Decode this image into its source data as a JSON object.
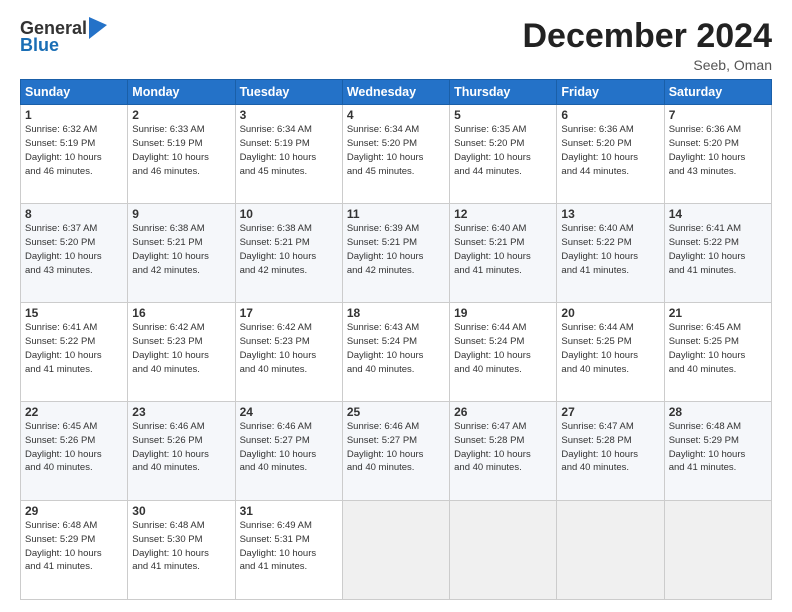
{
  "header": {
    "logo_line1": "General",
    "logo_line2": "Blue",
    "month_title": "December 2024",
    "subtitle": "Seeb, Oman"
  },
  "days_of_week": [
    "Sunday",
    "Monday",
    "Tuesday",
    "Wednesday",
    "Thursday",
    "Friday",
    "Saturday"
  ],
  "weeks": [
    [
      {
        "day": "1",
        "info": "Sunrise: 6:32 AM\nSunset: 5:19 PM\nDaylight: 10 hours\nand 46 minutes."
      },
      {
        "day": "2",
        "info": "Sunrise: 6:33 AM\nSunset: 5:19 PM\nDaylight: 10 hours\nand 46 minutes."
      },
      {
        "day": "3",
        "info": "Sunrise: 6:34 AM\nSunset: 5:19 PM\nDaylight: 10 hours\nand 45 minutes."
      },
      {
        "day": "4",
        "info": "Sunrise: 6:34 AM\nSunset: 5:20 PM\nDaylight: 10 hours\nand 45 minutes."
      },
      {
        "day": "5",
        "info": "Sunrise: 6:35 AM\nSunset: 5:20 PM\nDaylight: 10 hours\nand 44 minutes."
      },
      {
        "day": "6",
        "info": "Sunrise: 6:36 AM\nSunset: 5:20 PM\nDaylight: 10 hours\nand 44 minutes."
      },
      {
        "day": "7",
        "info": "Sunrise: 6:36 AM\nSunset: 5:20 PM\nDaylight: 10 hours\nand 43 minutes."
      }
    ],
    [
      {
        "day": "8",
        "info": "Sunrise: 6:37 AM\nSunset: 5:20 PM\nDaylight: 10 hours\nand 43 minutes."
      },
      {
        "day": "9",
        "info": "Sunrise: 6:38 AM\nSunset: 5:21 PM\nDaylight: 10 hours\nand 42 minutes."
      },
      {
        "day": "10",
        "info": "Sunrise: 6:38 AM\nSunset: 5:21 PM\nDaylight: 10 hours\nand 42 minutes."
      },
      {
        "day": "11",
        "info": "Sunrise: 6:39 AM\nSunset: 5:21 PM\nDaylight: 10 hours\nand 42 minutes."
      },
      {
        "day": "12",
        "info": "Sunrise: 6:40 AM\nSunset: 5:21 PM\nDaylight: 10 hours\nand 41 minutes."
      },
      {
        "day": "13",
        "info": "Sunrise: 6:40 AM\nSunset: 5:22 PM\nDaylight: 10 hours\nand 41 minutes."
      },
      {
        "day": "14",
        "info": "Sunrise: 6:41 AM\nSunset: 5:22 PM\nDaylight: 10 hours\nand 41 minutes."
      }
    ],
    [
      {
        "day": "15",
        "info": "Sunrise: 6:41 AM\nSunset: 5:22 PM\nDaylight: 10 hours\nand 41 minutes."
      },
      {
        "day": "16",
        "info": "Sunrise: 6:42 AM\nSunset: 5:23 PM\nDaylight: 10 hours\nand 40 minutes."
      },
      {
        "day": "17",
        "info": "Sunrise: 6:42 AM\nSunset: 5:23 PM\nDaylight: 10 hours\nand 40 minutes."
      },
      {
        "day": "18",
        "info": "Sunrise: 6:43 AM\nSunset: 5:24 PM\nDaylight: 10 hours\nand 40 minutes."
      },
      {
        "day": "19",
        "info": "Sunrise: 6:44 AM\nSunset: 5:24 PM\nDaylight: 10 hours\nand 40 minutes."
      },
      {
        "day": "20",
        "info": "Sunrise: 6:44 AM\nSunset: 5:25 PM\nDaylight: 10 hours\nand 40 minutes."
      },
      {
        "day": "21",
        "info": "Sunrise: 6:45 AM\nSunset: 5:25 PM\nDaylight: 10 hours\nand 40 minutes."
      }
    ],
    [
      {
        "day": "22",
        "info": "Sunrise: 6:45 AM\nSunset: 5:26 PM\nDaylight: 10 hours\nand 40 minutes."
      },
      {
        "day": "23",
        "info": "Sunrise: 6:46 AM\nSunset: 5:26 PM\nDaylight: 10 hours\nand 40 minutes."
      },
      {
        "day": "24",
        "info": "Sunrise: 6:46 AM\nSunset: 5:27 PM\nDaylight: 10 hours\nand 40 minutes."
      },
      {
        "day": "25",
        "info": "Sunrise: 6:46 AM\nSunset: 5:27 PM\nDaylight: 10 hours\nand 40 minutes."
      },
      {
        "day": "26",
        "info": "Sunrise: 6:47 AM\nSunset: 5:28 PM\nDaylight: 10 hours\nand 40 minutes."
      },
      {
        "day": "27",
        "info": "Sunrise: 6:47 AM\nSunset: 5:28 PM\nDaylight: 10 hours\nand 40 minutes."
      },
      {
        "day": "28",
        "info": "Sunrise: 6:48 AM\nSunset: 5:29 PM\nDaylight: 10 hours\nand 41 minutes."
      }
    ],
    [
      {
        "day": "29",
        "info": "Sunrise: 6:48 AM\nSunset: 5:29 PM\nDaylight: 10 hours\nand 41 minutes."
      },
      {
        "day": "30",
        "info": "Sunrise: 6:48 AM\nSunset: 5:30 PM\nDaylight: 10 hours\nand 41 minutes."
      },
      {
        "day": "31",
        "info": "Sunrise: 6:49 AM\nSunset: 5:31 PM\nDaylight: 10 hours\nand 41 minutes."
      },
      {
        "day": "",
        "info": ""
      },
      {
        "day": "",
        "info": ""
      },
      {
        "day": "",
        "info": ""
      },
      {
        "day": "",
        "info": ""
      }
    ]
  ]
}
